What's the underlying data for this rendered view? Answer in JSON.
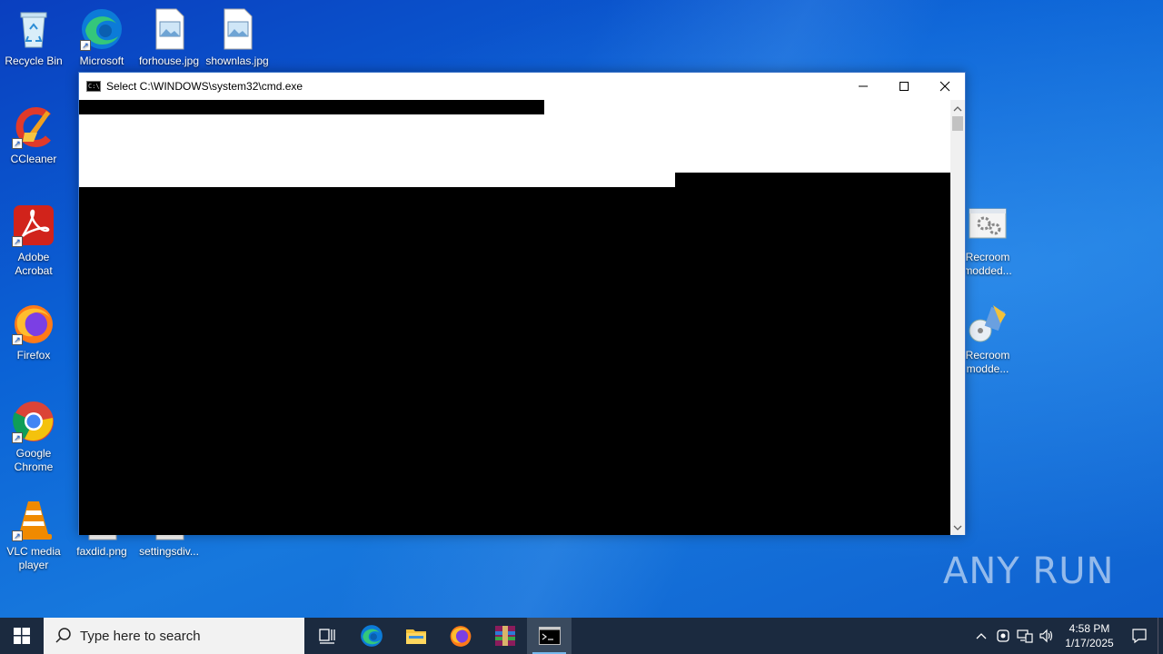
{
  "desktop": {
    "icons": [
      {
        "label": "Recycle Bin",
        "icon": "recycle-bin-icon"
      },
      {
        "label": "Microsoft Edge",
        "icon": "edge-icon"
      },
      {
        "label": "forhouse.jpg",
        "icon": "image-file-icon"
      },
      {
        "label": "shownlas.jpg",
        "icon": "image-file-icon"
      },
      {
        "label": "CCleaner",
        "icon": "ccleaner-icon"
      },
      {
        "label": "Adobe Acrobat",
        "icon": "acrobat-icon"
      },
      {
        "label": "Firefox",
        "icon": "firefox-icon"
      },
      {
        "label": "Google Chrome",
        "icon": "chrome-icon"
      },
      {
        "label": "VLC media player",
        "icon": "vlc-icon"
      },
      {
        "label": "faxdid.png",
        "icon": "image-file-icon"
      },
      {
        "label": "settingsdiv...",
        "icon": "image-file-icon"
      },
      {
        "label": "Recroom modded...",
        "icon": "settings-file-icon"
      },
      {
        "label": "Recroom modde...",
        "icon": "installer-icon"
      }
    ],
    "watermark": "ANY RUN"
  },
  "window": {
    "title": "Select C:\\WINDOWS\\system32\\cmd.exe",
    "app_icon": "cmd-icon"
  },
  "taskbar": {
    "search_placeholder": "Type here to search",
    "apps": [
      "task-view-icon",
      "edge-icon",
      "file-explorer-icon",
      "firefox-icon",
      "winrar-icon",
      "cmd-icon"
    ],
    "active_app": "cmd-icon",
    "clock_time": "4:58 PM",
    "clock_date": "1/17/2025"
  }
}
